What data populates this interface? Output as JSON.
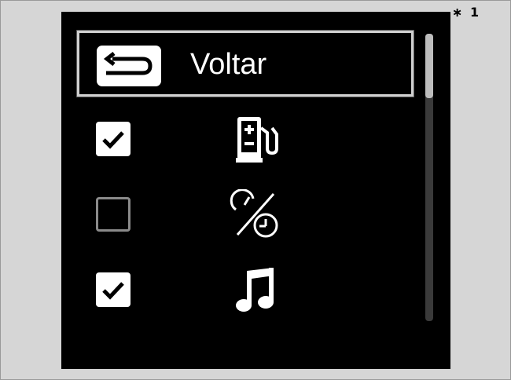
{
  "footnote": "∗ 1",
  "menu": {
    "back": {
      "label": "Voltar",
      "icon": "return-arrow-icon"
    },
    "items": [
      {
        "checked": true,
        "icon": "fuel-pump-charging-icon"
      },
      {
        "checked": false,
        "icon": "speedometer-clock-icon"
      },
      {
        "checked": true,
        "icon": "music-note-icon"
      }
    ]
  },
  "scroll": {
    "position_fraction": 0.0,
    "visible_fraction": 0.22
  },
  "colors": {
    "background": "#d6d6d6",
    "screen": "#000000",
    "foreground": "#ffffff",
    "selection_border": "#d0d0d0"
  }
}
